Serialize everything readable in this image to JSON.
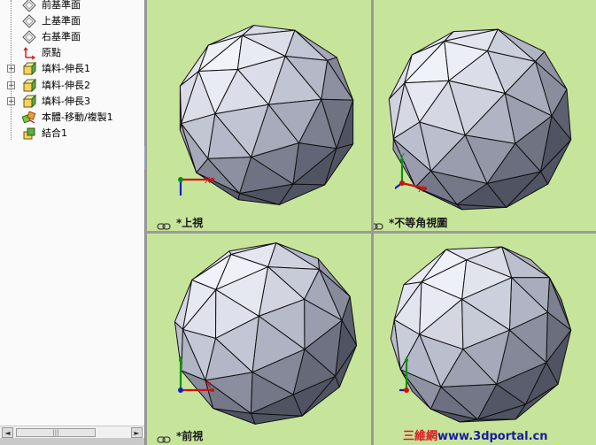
{
  "feature_tree": {
    "items": [
      {
        "label": "前基準面",
        "icon": "plane-icon",
        "expandable": false
      },
      {
        "label": "上基準面",
        "icon": "plane-icon",
        "expandable": false
      },
      {
        "label": "右基準面",
        "icon": "plane-icon",
        "expandable": false
      },
      {
        "label": "原點",
        "icon": "origin-icon",
        "expandable": false
      },
      {
        "label": "填料-伸長1",
        "icon": "boss-extrude-icon",
        "expandable": true
      },
      {
        "label": "填料-伸長2",
        "icon": "boss-extrude-icon",
        "expandable": true
      },
      {
        "label": "填料-伸長3",
        "icon": "boss-extrude-icon",
        "expandable": true
      },
      {
        "label": "本體-移動/複製1",
        "icon": "move-copy-body-icon",
        "expandable": false
      },
      {
        "label": "結合1",
        "icon": "combine-icon",
        "expandable": false
      }
    ]
  },
  "viewports": [
    {
      "id": "top",
      "label": "*上視",
      "triad": {
        "x_label": "X",
        "z_label": "Z"
      }
    },
    {
      "id": "iso",
      "label": "*不等角視圖",
      "triad": {
        "x_label": "X",
        "y_label": "Y",
        "z_label": "Z"
      }
    },
    {
      "id": "front",
      "label": "*前視",
      "triad": {
        "x_label": "X",
        "y_label": "Y"
      }
    },
    {
      "id": "right",
      "label": "",
      "triad": {
        "y_label": "Y",
        "z_label": "Z"
      }
    }
  ],
  "colors": {
    "viewport_bg": "#c6e59a",
    "sphere_light": "#f1f3fb",
    "sphere_mid": "#a6aabb",
    "sphere_dark": "#4f5362",
    "axis_x": "#d01010",
    "axis_y": "#109010",
    "axis_z": "#1020c0"
  },
  "watermark": {
    "part1": "三維網",
    "part2": "www.3dportal.cn"
  },
  "scrollbar": {
    "left_arrow": "◄",
    "right_arrow": "►",
    "grip": "|||"
  }
}
